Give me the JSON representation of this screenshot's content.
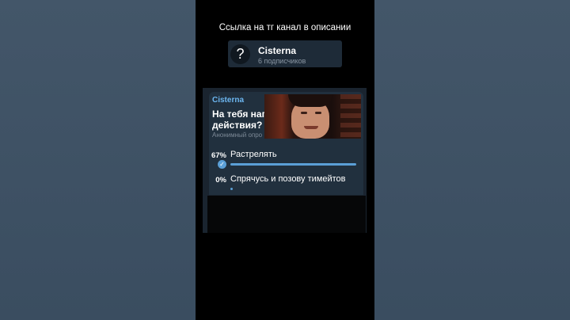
{
  "caption": "Ссылка на тг канал в описании",
  "channel": {
    "avatar_glyph": "?",
    "name": "Cisterna",
    "subscribers": "6 подписчиков"
  },
  "poll": {
    "author": "Cisterna",
    "question_line1": "На тебя напа",
    "question_line2": "действия?",
    "type": "Анонимный опро",
    "accent_color": "#5b9fd6",
    "options": [
      {
        "percent": "67%",
        "label": "Растрелять",
        "fraction": 0.67,
        "selected": true
      },
      {
        "percent": "0%",
        "label": "Спрячусь и позову тимейтов",
        "fraction": 0.0,
        "selected": false
      }
    ]
  }
}
